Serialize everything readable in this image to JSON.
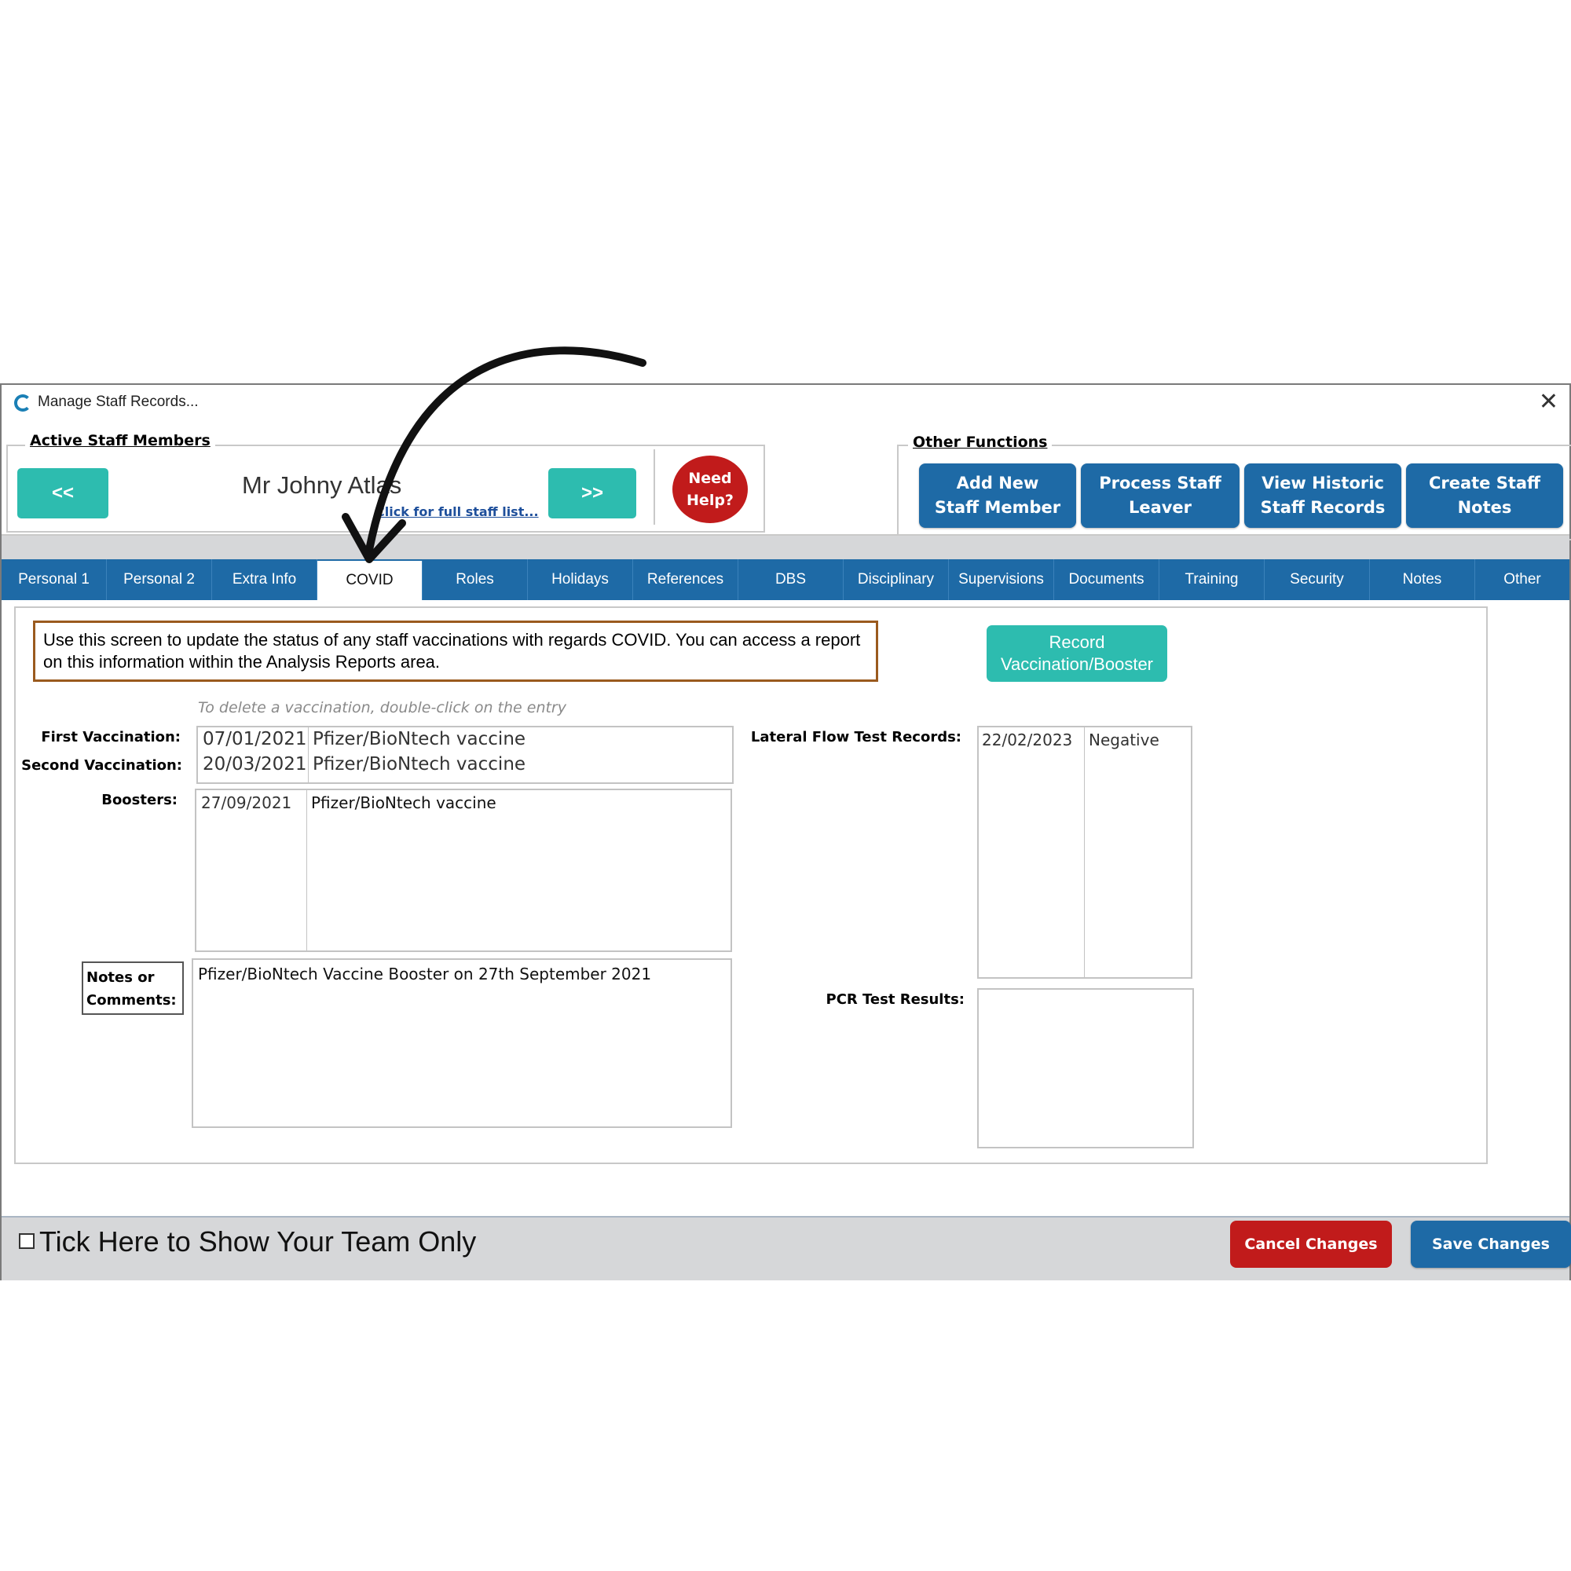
{
  "window": {
    "title": "Manage Staff Records...",
    "close_icon": "close-icon",
    "logo": "app-logo-c"
  },
  "active_staff": {
    "legend": "Active Staff Members",
    "prev_label": "<<",
    "next_label": ">>",
    "staff_name": "Mr Johny Atlas",
    "full_list_link": "Click for full staff list...",
    "help_label": "Need Help?"
  },
  "other_functions": {
    "legend": "Other Functions",
    "buttons": [
      {
        "label_line1": "Add New",
        "label_line2": "Staff Member"
      },
      {
        "label_line1": "Process Staff",
        "label_line2": "Leaver"
      },
      {
        "label_line1": "View Historic",
        "label_line2": "Staff Records"
      },
      {
        "label_line1": "Create Staff",
        "label_line2": "Notes"
      }
    ]
  },
  "tabs": [
    {
      "label": "Personal 1"
    },
    {
      "label": "Personal 2"
    },
    {
      "label": "Extra Info"
    },
    {
      "label": "COVID",
      "active": true
    },
    {
      "label": "Roles"
    },
    {
      "label": "Holidays"
    },
    {
      "label": "References"
    },
    {
      "label": "DBS"
    },
    {
      "label": "Disciplinary"
    },
    {
      "label": "Supervisions"
    },
    {
      "label": "Documents"
    },
    {
      "label": "Training"
    },
    {
      "label": "Security"
    },
    {
      "label": "Notes"
    },
    {
      "label": "Other"
    }
  ],
  "covid": {
    "info_text": "Use this screen to update the status of any staff vaccinations with regards COVID.  You can access a report on this information within the Analysis Reports area.",
    "record_button_line1": "Record",
    "record_button_line2": "Vaccination/Booster",
    "delete_hint": "To delete a vaccination, double-click on the entry",
    "first_vaccination_label": "First Vaccination:",
    "second_vaccination_label": "Second Vaccination:",
    "vaccinations": [
      {
        "date": "07/01/2021",
        "vaccine": "Pfizer/BioNtech vaccine"
      },
      {
        "date": "20/03/2021",
        "vaccine": "Pfizer/BioNtech vaccine"
      }
    ],
    "boosters_label": "Boosters:",
    "boosters": [
      {
        "date": "27/09/2021",
        "vaccine": "Pfizer/BioNtech vaccine"
      }
    ],
    "notes_label_line1": "Notes or",
    "notes_label_line2": "Comments:",
    "notes_value": "Pfizer/BioNtech Vaccine Booster on 27th September 2021",
    "lateral_flow_label": "Lateral Flow Test Records:",
    "lateral_flow": [
      {
        "date": "22/02/2023",
        "result": "Negative"
      }
    ],
    "pcr_label": "PCR Test Results:"
  },
  "footer": {
    "team_only_label": "Tick Here to Show Your Team Only",
    "team_only_checked": false,
    "cancel_label": "Cancel Changes",
    "save_label": "Save Changes"
  },
  "colors": {
    "accent_blue": "#1e6aa6",
    "teal": "#2dbcaf",
    "danger_red": "#c11b1b",
    "info_border": "#9a5a1e"
  }
}
